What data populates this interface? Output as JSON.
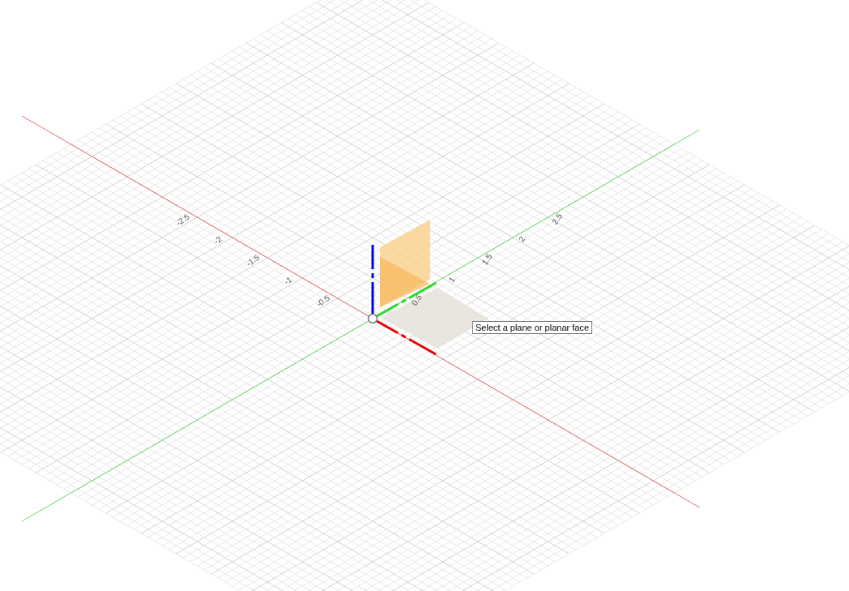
{
  "viewport": {
    "x_axis_ticks": [
      "-2.5",
      "-2",
      "-1.5",
      "-1",
      "-0.5"
    ],
    "y_axis_ticks": [
      "0.5",
      "1",
      "1.5",
      "2",
      "2.5"
    ]
  },
  "tooltip": {
    "text": "Select a plane or planar face"
  }
}
